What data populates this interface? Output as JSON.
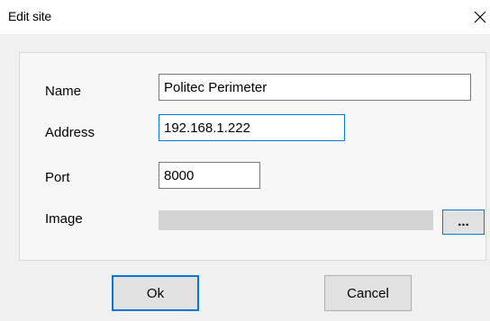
{
  "dialog": {
    "title": "Edit site"
  },
  "form": {
    "name_label": "Name",
    "name_value": "Politec Perimeter",
    "address_label": "Address",
    "address_value": "192.168.1.222",
    "port_label": "Port",
    "port_value": "8000",
    "image_label": "Image",
    "browse_label": "..."
  },
  "buttons": {
    "ok_label": "Ok",
    "cancel_label": "Cancel"
  },
  "colors": {
    "accent": "#0078d7",
    "background": "#f0f0f0"
  },
  "icons": {
    "close": "close-icon"
  }
}
